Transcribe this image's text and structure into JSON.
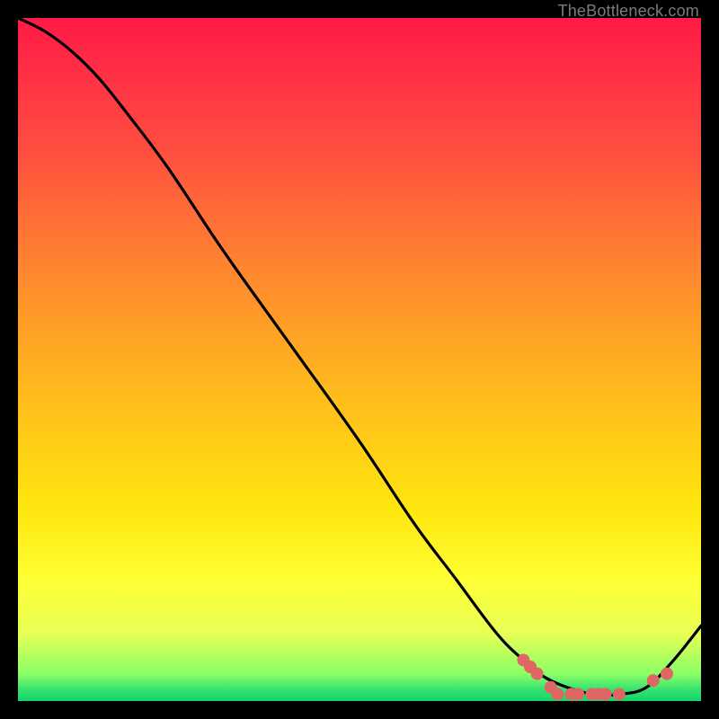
{
  "attribution": "TheBottleneck.com",
  "colors": {
    "curve": "#000000",
    "marker": "#e06666",
    "background_border": "#000000"
  },
  "chart_data": {
    "type": "line",
    "title": "",
    "xlabel": "",
    "ylabel": "",
    "xlim": [
      0,
      100
    ],
    "ylim": [
      0,
      100
    ],
    "grid": false,
    "legend": false,
    "annotations": [],
    "series": [
      {
        "name": "curve",
        "x": [
          0,
          4,
          8,
          12,
          16,
          22,
          30,
          40,
          50,
          58,
          64,
          70,
          74,
          78,
          84,
          88,
          92,
          96,
          100
        ],
        "y": [
          100,
          98,
          95,
          91,
          86,
          78,
          66,
          52,
          38,
          26,
          18,
          10,
          6,
          3,
          1,
          1,
          2,
          6,
          11
        ]
      }
    ],
    "markers": [
      {
        "x": 74,
        "y": 6
      },
      {
        "x": 75,
        "y": 5
      },
      {
        "x": 76,
        "y": 4
      },
      {
        "x": 78,
        "y": 2
      },
      {
        "x": 79,
        "y": 1
      },
      {
        "x": 81,
        "y": 1
      },
      {
        "x": 82,
        "y": 1
      },
      {
        "x": 84,
        "y": 1
      },
      {
        "x": 85,
        "y": 1
      },
      {
        "x": 86,
        "y": 1
      },
      {
        "x": 88,
        "y": 1
      },
      {
        "x": 93,
        "y": 3
      },
      {
        "x": 95,
        "y": 4
      }
    ]
  }
}
